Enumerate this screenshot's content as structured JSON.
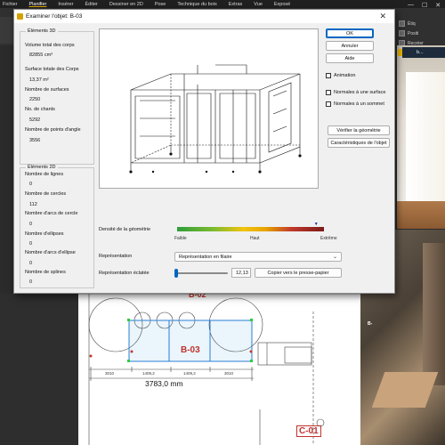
{
  "menubar": {
    "items": [
      "Fichier",
      "Planifier",
      "Insérer",
      "Éditer",
      "Dessiner en 2D",
      "Pose",
      "Technique du bois",
      "Extras",
      "Vue",
      "Exposé"
    ],
    "active_index": 1
  },
  "ribbon_right": {
    "items": [
      "Étiq",
      "Positi",
      "Recréer"
    ]
  },
  "view3d": {
    "tab_label": "b..."
  },
  "render": {
    "label": "B-"
  },
  "plan": {
    "label_b02": "B-02",
    "label_b03": "B-03",
    "label_c01": "C-01",
    "dim_total": "3783,0 mm",
    "dim_left": "3010",
    "dim_mid1": "1409,2",
    "dim_mid2": "1409,2",
    "dim_right": "3010"
  },
  "dialog": {
    "title": "Examiner l'objet: B-03",
    "close_symbol": "✕",
    "elements3d": {
      "title": "Éléments 3D",
      "volume_label": "Volume total des corps",
      "volume_value": "82855 cm³",
      "surface_label": "Surface totale des Corps",
      "surface_value": "13,37 m²",
      "num_surfaces_label": "Nombre de surfaces",
      "num_surfaces_value": "2250",
      "num_edges_label": "No. de chants",
      "num_edges_value": "5292",
      "num_vertices_label": "Nombre de points d'angle",
      "num_vertices_value": "3556"
    },
    "elements2d": {
      "title": "Éléments 2D",
      "lines_label": "Nombre de lignes",
      "lines_value": "0",
      "circles_label": "Nombre de cercles",
      "circles_value": "112",
      "arcs_label": "Nombre d'arcs de cercle",
      "arcs_value": "0",
      "ellipses_label": "Nombre d'ellipses",
      "ellipses_value": "0",
      "ellipse_arcs_label": "Nombre d'arcs d'ellipse",
      "ellipse_arcs_value": "0",
      "splines_label": "Nombre de splines",
      "splines_value": "0"
    },
    "buttons": {
      "ok": "OK",
      "cancel": "Annuler",
      "help": "Aide",
      "verify": "Vérifier la géométrie",
      "characteristics": "Caractéristiques de l'objet",
      "copy": "Copier vers le presse-papier"
    },
    "checkboxes": {
      "animation": "Animation",
      "normals_surface": "Normales à une surface",
      "normals_vertex": "Normales à un sommet"
    },
    "density": {
      "label": "Densité de la géométrie",
      "low": "Faible",
      "high": "Haut",
      "extreme": "Extrême",
      "level": 0.95
    },
    "representation": {
      "label": "Représentation",
      "selected": "Représentation en filaire"
    },
    "exploded": {
      "label": "Représentation éclatée",
      "value": "12,13"
    }
  }
}
